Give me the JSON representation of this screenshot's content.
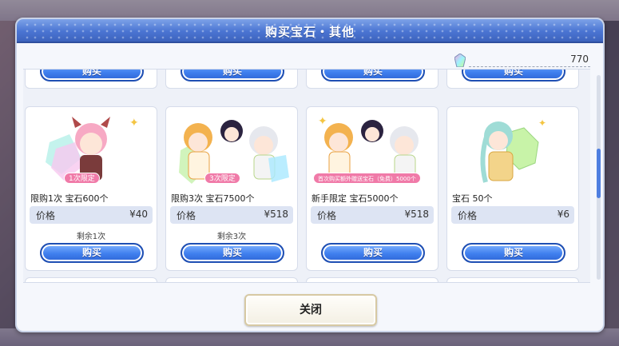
{
  "dialog": {
    "title": "购买宝石・其他",
    "gem_count": "770"
  },
  "products": [
    {
      "description": "限购1次 宝石600个",
      "badge": "1次限定",
      "price_label": "价格",
      "price": "¥40",
      "remaining": "剩余1次",
      "buy_label": "购买",
      "art_icon": "character-gem-pack-icon"
    },
    {
      "description": "限购3次 宝石7500个",
      "badge": "3次限定",
      "price_label": "价格",
      "price": "¥518",
      "remaining": "剩余3次",
      "buy_label": "购买",
      "art_icon": "character-gem-pack-icon"
    },
    {
      "description": "新手限定 宝石5000个",
      "badge": "首次购买额外赠送宝石（免费）5000个",
      "price_label": "价格",
      "price": "¥518",
      "remaining": "",
      "buy_label": "购买",
      "art_icon": "character-gem-pack-icon"
    },
    {
      "description": "宝石 50个",
      "badge": "",
      "price_label": "价格",
      "price": "¥6",
      "remaining": "",
      "buy_label": "购买",
      "art_icon": "character-gem-pack-icon"
    }
  ],
  "top_row_buy_labels": [
    "购买",
    "购买",
    "购买",
    "购买"
  ],
  "close_label": "关闭",
  "colors": {
    "accent_blue": "#3f7fee",
    "title_blue": "#4a74d2",
    "badge_pink": "#f07aa8"
  }
}
